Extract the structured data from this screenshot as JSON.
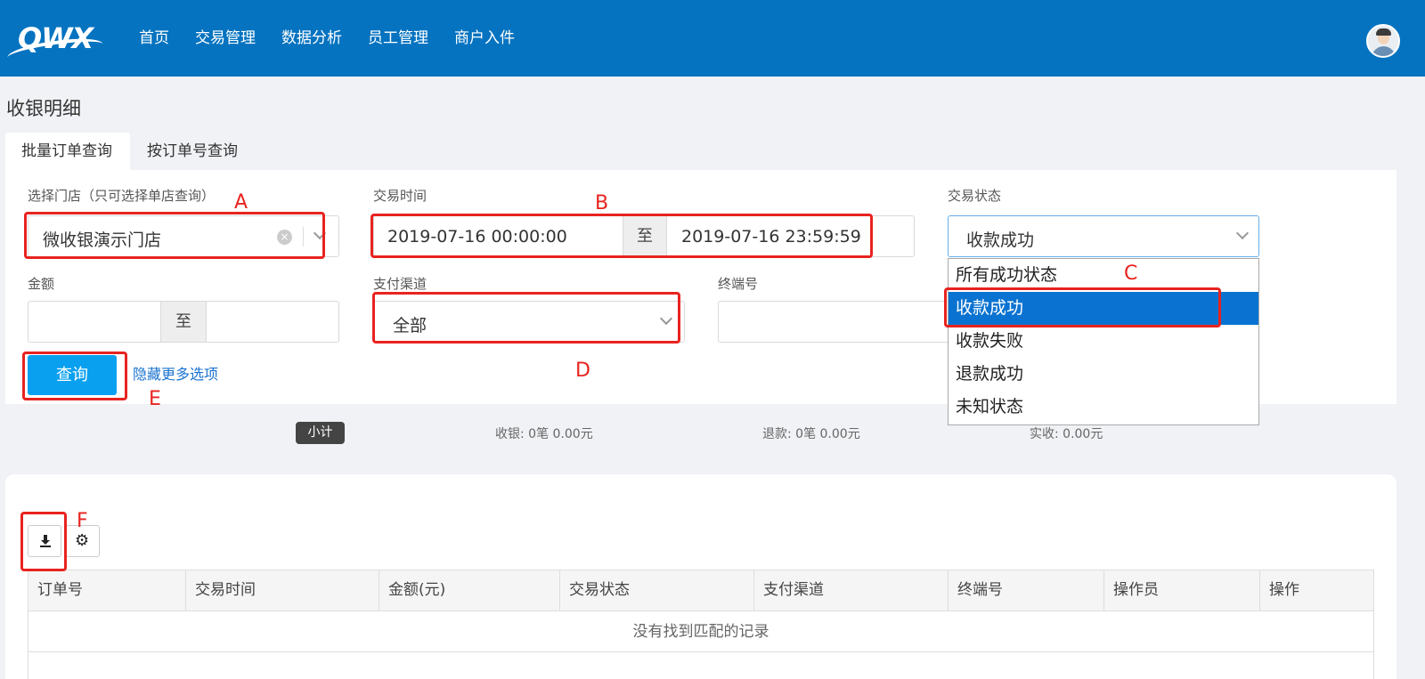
{
  "header": {
    "logo_text": "QWX",
    "nav": [
      "首页",
      "交易管理",
      "数据分析",
      "员工管理",
      "商户入件"
    ]
  },
  "page_title": "收银明细",
  "tabs": [
    {
      "label": "批量订单查询",
      "active": true
    },
    {
      "label": "按订单号查询",
      "active": false
    }
  ],
  "filters": {
    "store": {
      "label": "选择门店（只可选择单店查询）",
      "value": "微收银演示门店"
    },
    "trade_time": {
      "label": "交易时间",
      "start": "2019-07-16 00:00:00",
      "separator": "至",
      "end": "2019-07-16 23:59:59"
    },
    "trade_status": {
      "label": "交易状态",
      "value": "收款成功",
      "options": [
        "所有成功状态",
        "收款成功",
        "收款失败",
        "退款成功",
        "未知状态"
      ],
      "selected_index": 1
    },
    "amount": {
      "label": "金额",
      "separator": "至",
      "min": "",
      "max": ""
    },
    "pay_channel": {
      "label": "支付渠道",
      "value": "全部"
    },
    "terminal": {
      "label": "终端号",
      "value": ""
    }
  },
  "actions": {
    "query_label": "查询",
    "toggle_more_label": "隐藏更多选项"
  },
  "summary": {
    "badge": "小计",
    "collect": "收银: 0笔   0.00元",
    "refund": "退款:   0笔   0.00元",
    "net": "实收:   0.00元"
  },
  "table": {
    "columns": [
      "订单号",
      "交易时间",
      "金额(元)",
      "交易状态",
      "支付渠道",
      "终端号",
      "操作员",
      "操作"
    ],
    "empty_text": "没有找到匹配的记录"
  },
  "annotations": [
    "A",
    "B",
    "C",
    "D",
    "E",
    "F"
  ],
  "colors": {
    "header": "#0573c0",
    "accent": "#0aa0f0",
    "annotation": "#e8231f",
    "selected": "#0a73d1"
  },
  "icons": {
    "download": "download-icon",
    "settings": "gear-icon",
    "clear": "clear-icon",
    "dropdown": "chevron-down-icon"
  }
}
